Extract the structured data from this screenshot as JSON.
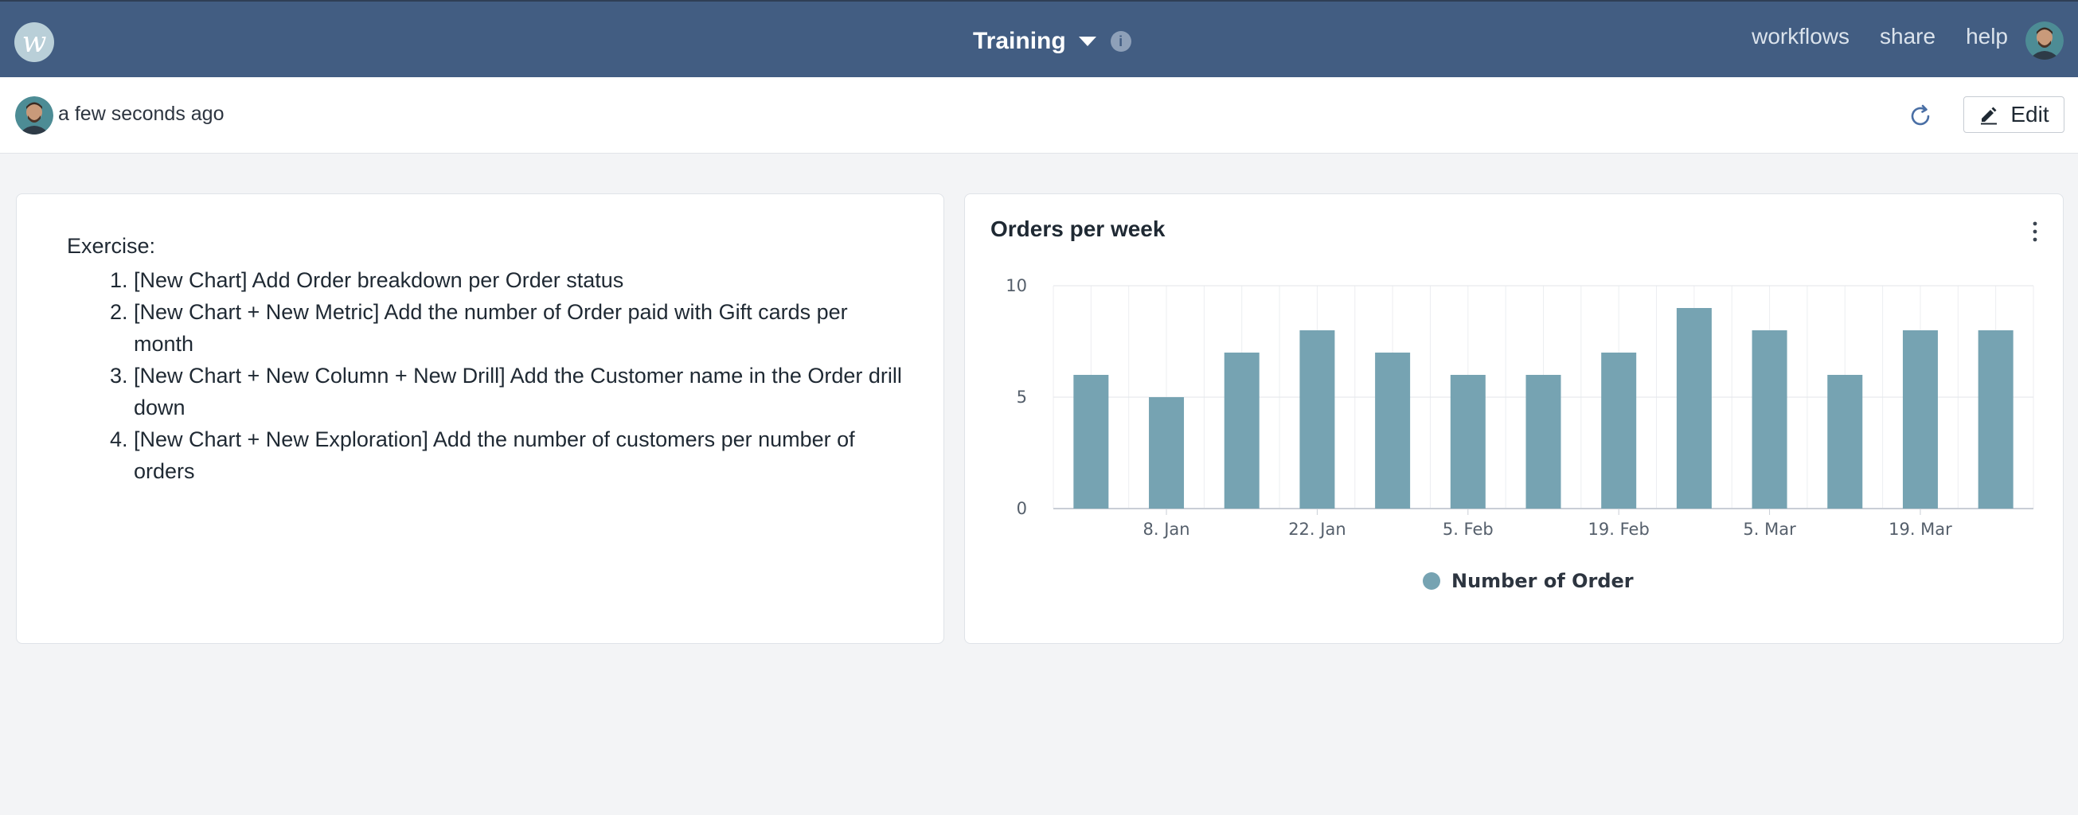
{
  "topbar": {
    "logo_icon": "workspace-logo-icon",
    "title": "Training",
    "info_icon": "info-icon",
    "links": [
      "workflows",
      "share",
      "help"
    ],
    "avatar_icon": "user-avatar"
  },
  "subbar": {
    "timestamp": "a few seconds ago",
    "refresh_icon": "refresh-icon",
    "edit_label": "Edit",
    "edit_icon": "pencil-icon"
  },
  "text_card": {
    "heading": "Exercise:",
    "items": [
      "[New Chart] Add Order breakdown per Order status",
      "[New Chart + New Metric] Add the number of Order paid with Gift cards per month",
      "[New Chart + New Column + New Drill] Add the Customer name in the Order drill down",
      "[New Chart + New Exploration] Add the number of customers per number of orders"
    ]
  },
  "chart_card": {
    "title": "Orders per week",
    "menu_icon": "more-vertical-icon"
  },
  "colors": {
    "topbar": "#425d82",
    "bar": "#76a3b2",
    "background": "#f3f4f6"
  },
  "chart_data": {
    "type": "bar",
    "title": "Orders per week",
    "xlabel": "",
    "ylabel": "",
    "ylim": [
      0,
      10
    ],
    "yticks": [
      0,
      5,
      10
    ],
    "xtick_labels": [
      "8. Jan",
      "22. Jan",
      "5. Feb",
      "19. Feb",
      "5. Mar",
      "19. Mar"
    ],
    "x": [
      "2024-01-01",
      "2024-01-08",
      "2024-01-15",
      "2024-01-22",
      "2024-01-29",
      "2024-02-05",
      "2024-02-12",
      "2024-02-19",
      "2024-02-26",
      "2024-03-04",
      "2024-03-11",
      "2024-03-18",
      "2024-03-25"
    ],
    "series": [
      {
        "name": "Number of Order",
        "values": [
          6,
          5,
          7,
          8,
          7,
          6,
          6,
          7,
          9,
          8,
          6,
          8,
          8
        ]
      }
    ],
    "grid": true,
    "legend": "bottom-center"
  }
}
